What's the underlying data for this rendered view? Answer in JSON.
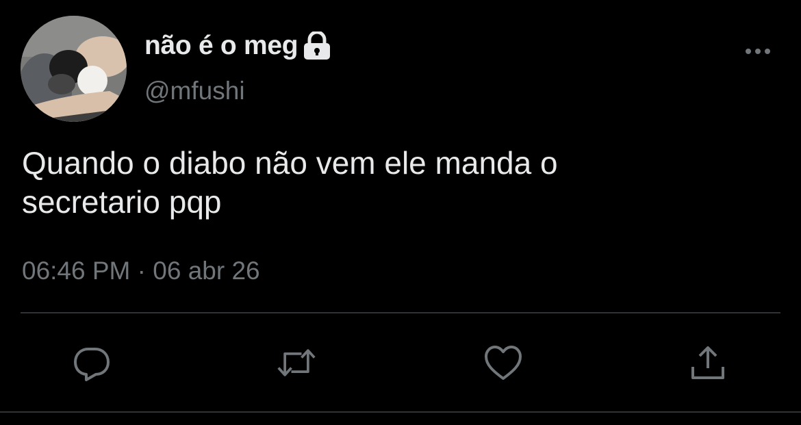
{
  "author": {
    "display_name": "não é o meg",
    "handle": "@mfushi",
    "protected_icon": "lock-icon",
    "avatar": "profile-photo"
  },
  "tweet": {
    "text": "Quando o diabo não vem ele manda o\nsecretario pqp",
    "time": "06:46 PM",
    "separator": "·",
    "date": "06 abr 26"
  },
  "actions": {
    "more_icon": "more-horizontal-icon",
    "reply_icon": "reply-icon",
    "retweet_icon": "retweet-icon",
    "like_icon": "heart-icon",
    "share_icon": "share-icon"
  },
  "colors": {
    "background": "#000000",
    "primary_text": "#e7e9ea",
    "secondary_text": "#71767b",
    "divider": "#2f3336"
  }
}
